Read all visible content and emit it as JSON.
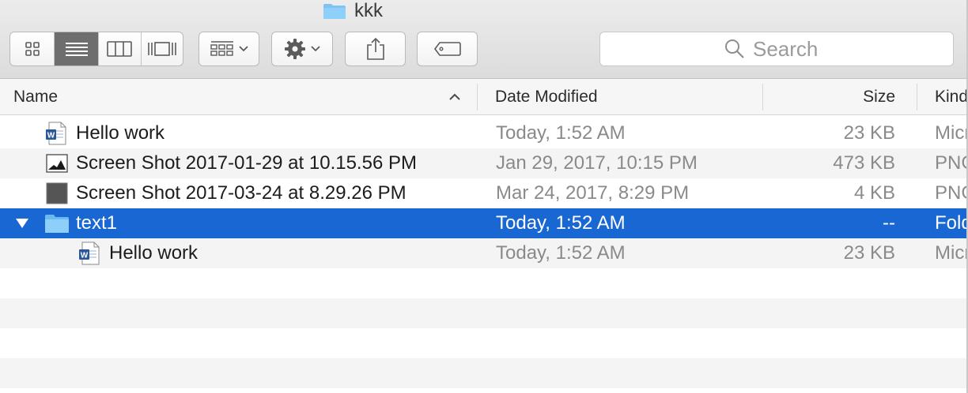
{
  "window": {
    "title": "kkk"
  },
  "toolbar": {
    "view_modes": [
      {
        "name": "icon-view-icon",
        "active": false
      },
      {
        "name": "list-view-icon",
        "active": true
      },
      {
        "name": "column-view-icon",
        "active": false
      },
      {
        "name": "cover-flow-icon",
        "active": false
      }
    ],
    "search": {
      "placeholder": "Search"
    }
  },
  "columns": {
    "name": "Name",
    "date_modified": "Date Modified",
    "size": "Size",
    "kind": "Kind"
  },
  "files": [
    {
      "name": "Hello work",
      "date": "Today, 1:52 AM",
      "size": "23 KB",
      "kind": "Microsoft Word document",
      "icon": "word-doc-icon"
    },
    {
      "name": "Screen Shot 2017-01-29 at 10.15.56 PM",
      "date": "Jan 29, 2017, 10:15 PM",
      "size": "473 KB",
      "kind": "PNG image",
      "icon": "image-thumbnail-icon"
    },
    {
      "name": "Screen Shot 2017-03-24 at 8.29.26 PM",
      "date": "Mar 24, 2017, 8:29 PM",
      "size": "4 KB",
      "kind": "PNG image",
      "icon": "image-thumbnail-dark-icon"
    },
    {
      "name": "text1",
      "date": "Today, 1:52 AM",
      "size": "--",
      "kind": "Folder",
      "icon": "folder-icon",
      "expanded": true,
      "selected": true
    },
    {
      "name": "Hello work",
      "date": "Today, 1:52 AM",
      "size": "23 KB",
      "kind": "Microsoft Word document",
      "icon": "word-doc-icon",
      "indent": 1
    }
  ],
  "colors": {
    "selection": "#1967d2",
    "folder": "#6ab9f0",
    "word_blue": "#2b579a"
  }
}
